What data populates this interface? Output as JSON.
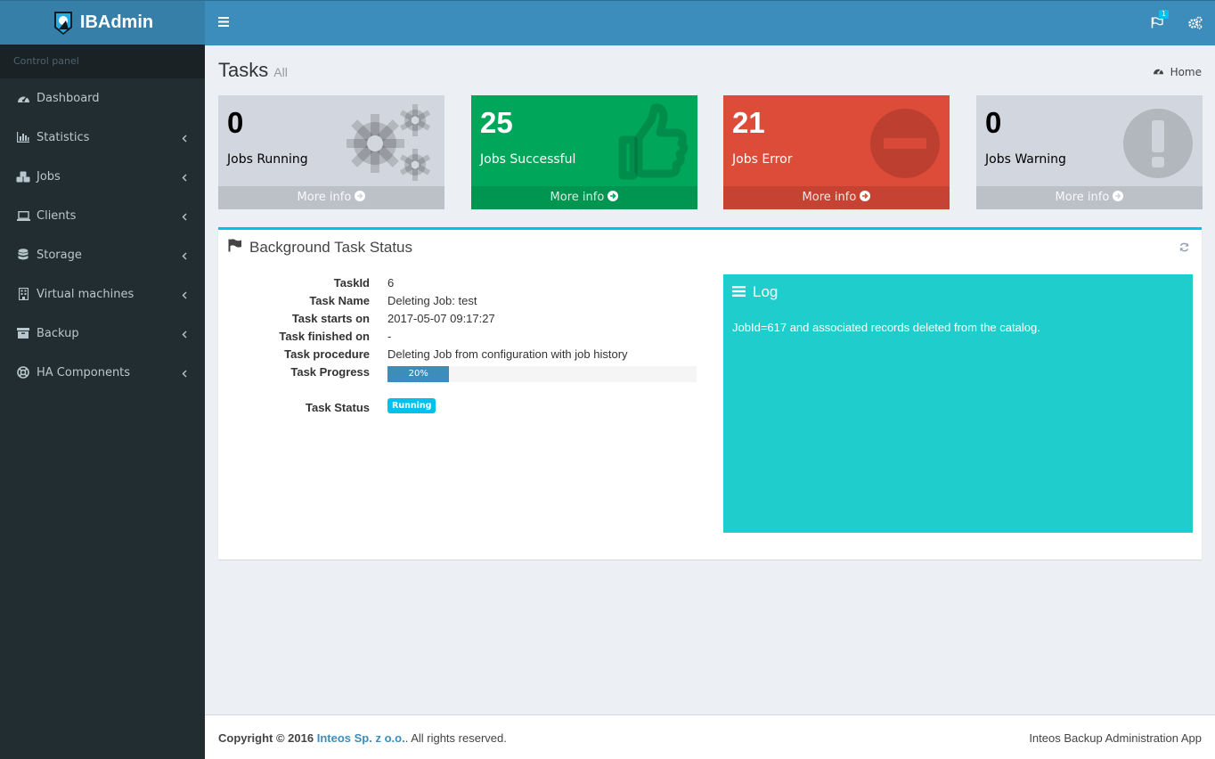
{
  "app": {
    "logo_text": "IBAdmin"
  },
  "sidebar": {
    "header": "Control panel",
    "items": [
      {
        "label": "Dashboard",
        "icon": "dashboard-icon"
      },
      {
        "label": "Statistics",
        "icon": "bar-chart-icon"
      },
      {
        "label": "Jobs",
        "icon": "cubes-icon"
      },
      {
        "label": "Clients",
        "icon": "laptop-icon"
      },
      {
        "label": "Storage",
        "icon": "database-icon"
      },
      {
        "label": "Virtual machines",
        "icon": "building-icon"
      },
      {
        "label": "Backup",
        "icon": "archive-icon"
      },
      {
        "label": "HA Components",
        "icon": "life-ring-icon"
      }
    ]
  },
  "topbar": {
    "notifications_count": "1"
  },
  "page": {
    "title": "Tasks",
    "subtitle": "All",
    "breadcrumb_home": "Home"
  },
  "stats": [
    {
      "value": "0",
      "label": "Jobs Running",
      "more": "More info",
      "color": "#d2d6de"
    },
    {
      "value": "25",
      "label": "Jobs Successful",
      "more": "More info",
      "color": "#00a65a"
    },
    {
      "value": "21",
      "label": "Jobs Error",
      "more": "More info",
      "color": "#dd4b39"
    },
    {
      "value": "0",
      "label": "Jobs Warning",
      "more": "More info",
      "color": "#d2d6de"
    }
  ],
  "task_panel": {
    "title": "Background Task Status",
    "fields": {
      "taskid": {
        "label": "TaskId",
        "value": "6"
      },
      "name": {
        "label": "Task Name",
        "value": "Deleting Job: test"
      },
      "starts": {
        "label": "Task starts on",
        "value": "2017-05-07 09:17:27"
      },
      "finished": {
        "label": "Task finished on",
        "value": "-"
      },
      "procedure": {
        "label": "Task procedure",
        "value": "Deleting Job from configuration with job history"
      },
      "progress": {
        "label": "Task Progress",
        "value": 20,
        "text": "20%"
      },
      "status": {
        "label": "Task Status",
        "value": "Running"
      }
    }
  },
  "log": {
    "title": "Log",
    "text": "JobId=617 and associated records deleted from the catalog."
  },
  "footer": {
    "copyright_prefix": "Copyright © 2016",
    "company": "Inteos Sp. z o.o.",
    "copyright_suffix": ". All rights reserved.",
    "app_name": "Inteos Backup Administration App"
  },
  "colors": {
    "accent": "#3c8dbc",
    "sidebar": "#222d32",
    "log": "#1fcdcd",
    "info": "#00c0ef"
  }
}
